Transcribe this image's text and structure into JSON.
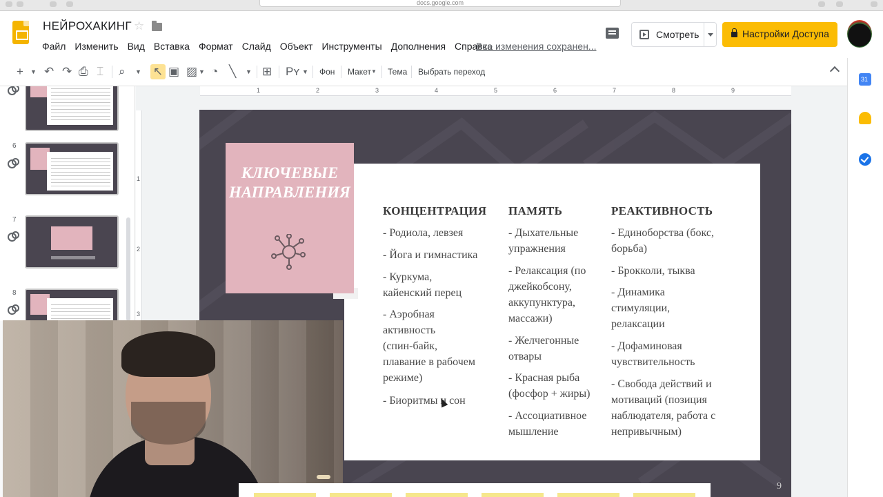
{
  "browser": {
    "url": "docs.google.com"
  },
  "app": {
    "title": "НЕЙРОХАКИНГ",
    "save_status": "Все изменения сохранен...",
    "present_label": "Смотреть",
    "share_label": "Настройки Доступа"
  },
  "menu": [
    "Файл",
    "Изменить",
    "Вид",
    "Вставка",
    "Формат",
    "Слайд",
    "Объект",
    "Инструменты",
    "Дополнения",
    "Справка"
  ],
  "toolbar": {
    "background_label": "Фон",
    "layout_label": "Макет",
    "theme_label": "Тема",
    "transition_label": "Выбрать переход"
  },
  "ruler": {
    "h_ticks": [
      "1",
      "2",
      "3",
      "4",
      "5",
      "6",
      "7",
      "8",
      "9"
    ],
    "v_ticks": [
      "1",
      "2",
      "3"
    ]
  },
  "filmstrip": {
    "slides": [
      {
        "number": "6"
      },
      {
        "number": "7"
      },
      {
        "number": "8"
      }
    ]
  },
  "slide": {
    "title": "КЛЮЧЕВЫЕ\nНАПРАВЛЕНИЯ",
    "page_number": "9",
    "columns": [
      {
        "heading": "КОНЦЕНТРАЦИЯ",
        "items": [
          "- Родиола, левзея",
          "- Йога и гимнастика",
          "- Куркума,\nкайенский перец",
          "- Аэробная\nактивность\n(спин-байк,\nплавание в рабочем\nрежиме)",
          "- Биоритмы и сон"
        ]
      },
      {
        "heading": "ПАМЯТЬ",
        "items": [
          "- Дыхательные\nупражнения",
          "- Релаксация (по\nджейкобсону,\nаккупунктура,\nмассажи)",
          "- Желчегонные\nотвары",
          "- Красная рыба\n(фосфор + жиры)",
          "- Ассоциативное\nмышление"
        ]
      },
      {
        "heading": "РЕАКТИВНОСТЬ",
        "items": [
          "- Единоборства (бокс,\nборьба)",
          "-  Брокколи, тыква",
          "-  Динамика\nстимуляции,\nрелаксации",
          "- Дофаминовая\nчувствительность",
          "- Свобода действий и\nмотиваций (позиция\nнаблюдателя, работа с\nнепривычным)"
        ]
      }
    ]
  },
  "colors": {
    "slide_bg": "#494550",
    "pink": "#e2b4bd",
    "share_yellow": "#fbbc04"
  }
}
